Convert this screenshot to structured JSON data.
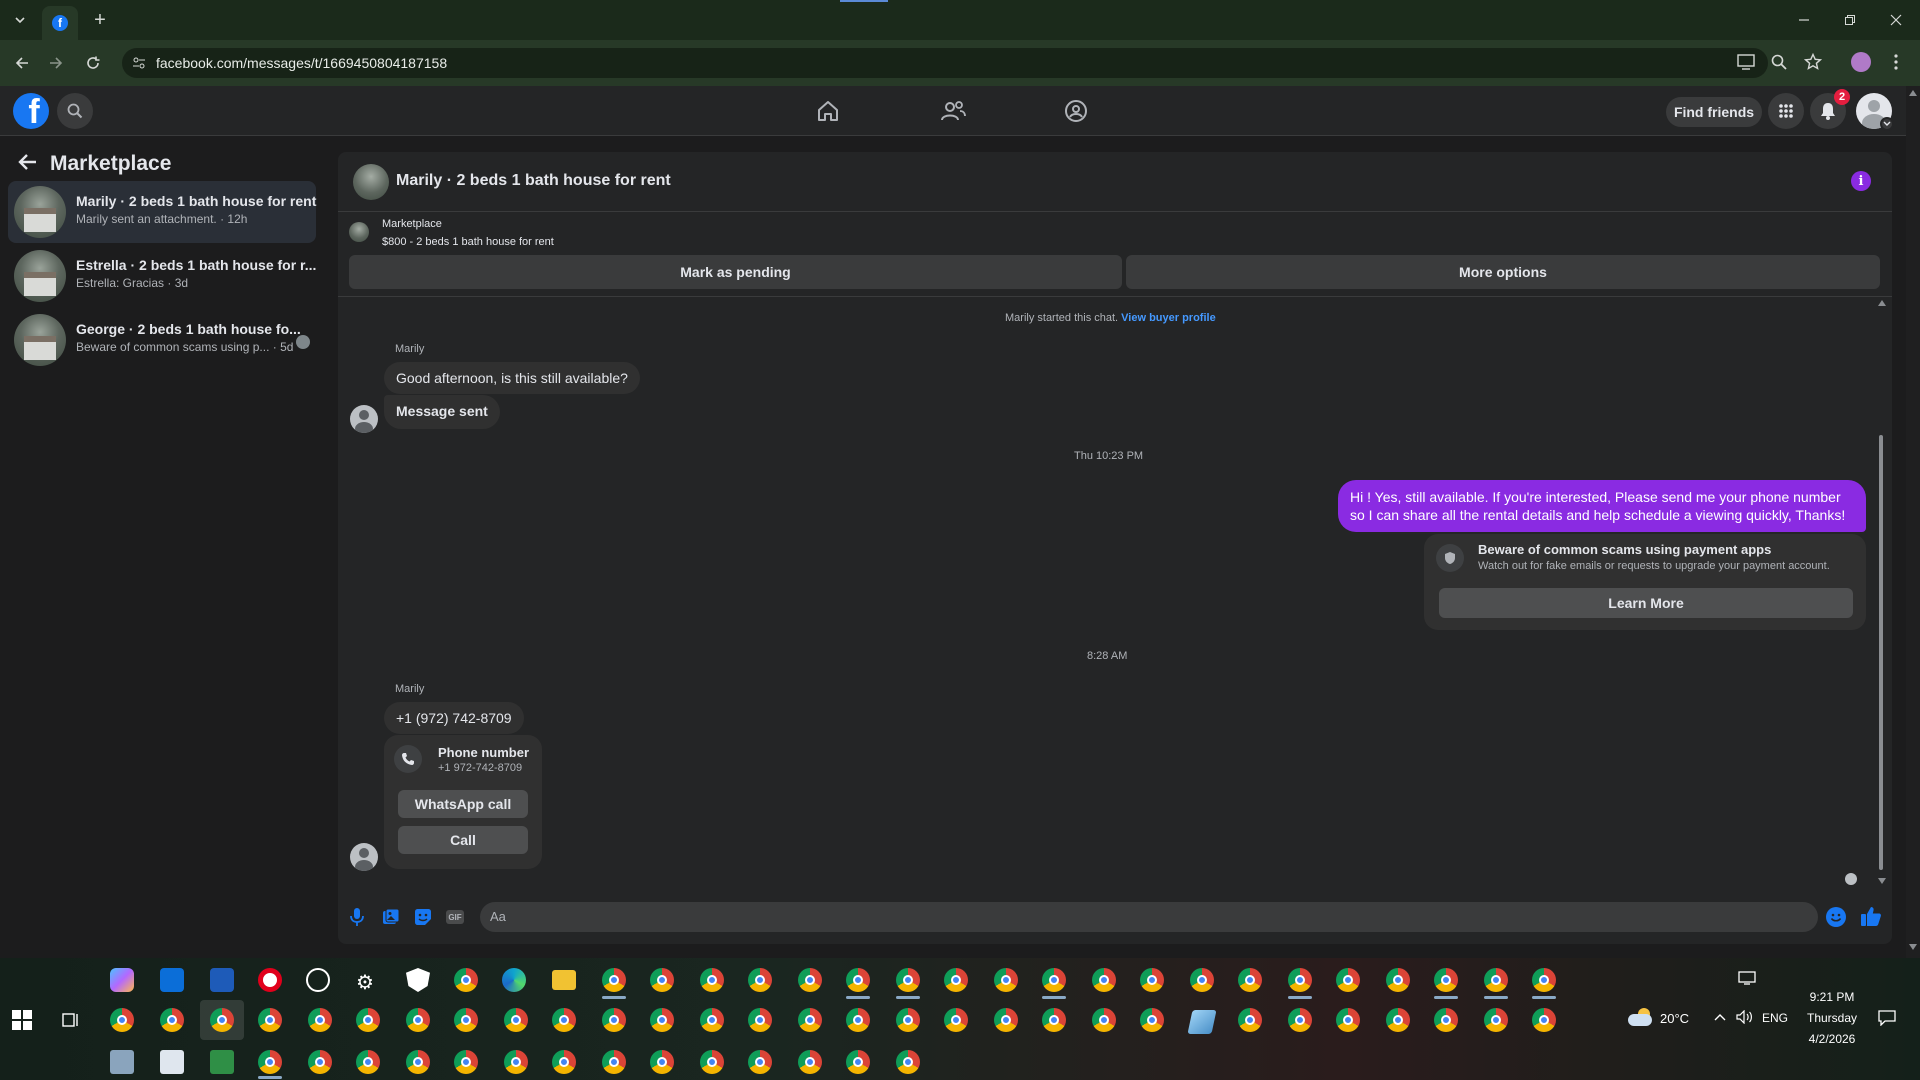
{
  "browser": {
    "url": "facebook.com/messages/t/1669450804187158",
    "new_tab_label": "+"
  },
  "header": {
    "find_friends": "Find friends",
    "notification_count": "2"
  },
  "sidebar": {
    "title": "Marketplace",
    "conversations": [
      {
        "name": "Marily · 2 beds 1 bath house for rent",
        "sub": "Marily sent an attachment. · 12h"
      },
      {
        "name": "Estrella · 2 beds 1 bath house for r...",
        "sub": "Estrella: Gracias · 3d"
      },
      {
        "name": "George · 2 beds 1 bath house fo...",
        "sub": "Beware of common scams using p... · 5d"
      }
    ]
  },
  "chat": {
    "title": "Marily · 2 beds 1 bath house for rent",
    "listing_source": "Marketplace",
    "listing_title": "$800 - 2 beds 1 bath house for rent",
    "mark_pending": "Mark as pending",
    "more_options": "More options",
    "started_text": "Marily started this chat.",
    "view_profile": "View buyer profile",
    "sender_1": "Marily",
    "msg_1": "Good afternoon, is this still available?",
    "msg_2": "Message sent",
    "time_1": "Thu 10:23 PM",
    "my_msg": "Hi ! Yes, still available. If you're interested, Please send me your phone number so I can share all the rental details and help schedule a viewing quickly, Thanks!",
    "scam_title": "Beware of common scams using payment apps",
    "scam_sub": "Watch out for fake emails or requests to upgrade your payment account.",
    "learn_more": "Learn More",
    "time_2": "8:28 AM",
    "sender_2": "Marily",
    "phone_msg": "+1 (972) 742-8709",
    "phone_card_title": "Phone number",
    "phone_card_number": "+1 972-742-8709",
    "whatsapp_call": "WhatsApp call",
    "call": "Call",
    "composer_placeholder": "Aa"
  },
  "taskbar": {
    "time": "9:21 PM",
    "day": "Thursday",
    "date": "4/2/2026",
    "weather": "20°C",
    "lang": "ENG"
  },
  "colors": {
    "accent": "#8a2be2",
    "link": "#4599ff",
    "fb_blue": "#1877f2"
  }
}
